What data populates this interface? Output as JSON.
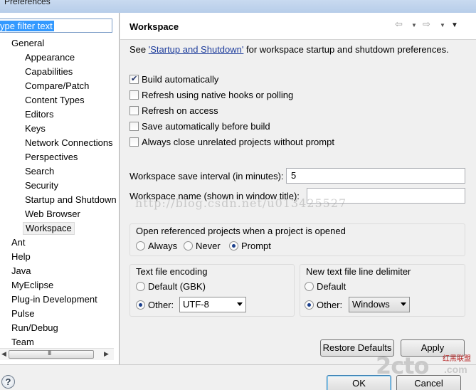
{
  "window": {
    "title": "Preferences"
  },
  "filter": {
    "placeholder": "type filter text",
    "text": "ype filter text"
  },
  "tree": {
    "general": "General",
    "general_children": [
      "Appearance",
      "Capabilities",
      "Compare/Patch",
      "Content Types",
      "Editors",
      "Keys",
      "Network Connections",
      "Perspectives",
      "Search",
      "Security",
      "Startup and Shutdown",
      "Web Browser",
      "Workspace"
    ],
    "selected": "Workspace",
    "top_level": [
      "Ant",
      "Help",
      "Java",
      "MyEclipse",
      "Plug-in Development",
      "Pulse",
      "Run/Debug",
      "Team"
    ],
    "scroll_grip": "III"
  },
  "page": {
    "title": "Workspace",
    "see_prefix": "See ",
    "see_link": "'Startup and Shutdown'",
    "see_suffix": " for workspace startup and shutdown preferences.",
    "options": [
      {
        "label": "Build automatically",
        "checked": true
      },
      {
        "label": "Refresh using native hooks or polling",
        "checked": false
      },
      {
        "label": "Refresh on access",
        "checked": false
      },
      {
        "label": "Save automatically before build",
        "checked": false
      },
      {
        "label": "Always close unrelated projects without prompt",
        "checked": false
      }
    ],
    "save_interval_label": "Workspace save interval (in minutes):",
    "save_interval_value": "5",
    "name_label": "Workspace name (shown in window title):",
    "name_value": "",
    "open_ref_title": "Open referenced projects when a project is opened",
    "open_ref_options": [
      "Always",
      "Never",
      "Prompt"
    ],
    "open_ref_selected": "Prompt",
    "encoding_title": "Text file encoding",
    "encoding_default": "Default (GBK)",
    "encoding_other": "Other:",
    "encoding_value": "UTF-8",
    "delimiter_title": "New text file line delimiter",
    "delimiter_default": "Default",
    "delimiter_other": "Other:",
    "delimiter_value": "Windows",
    "restore_defaults": "Restore Defaults",
    "apply": "Apply"
  },
  "footer": {
    "help": "?",
    "ok": "OK",
    "cancel": "Cancel"
  },
  "watermark": {
    "url": "http://blog.csdn.net/u013425527",
    "logo_big": "2cto",
    "logo_tld": ".com",
    "logo_small": "红黑联盟"
  },
  "colors": {
    "selection": "#3399ff",
    "link": "#1e3d9c",
    "radio_dot": "#1b3f8c"
  }
}
